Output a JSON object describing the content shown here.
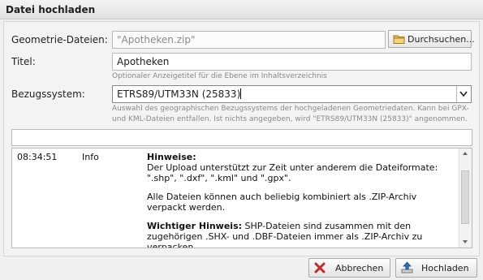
{
  "dialog": {
    "title": "Datei hochladen"
  },
  "form": {
    "file_label": "Geometrie-Dateien:",
    "file_value": "\"Apotheken.zip\"",
    "browse_label": "Durchsuchen...",
    "title_label": "Titel:",
    "title_value": "Apotheken",
    "title_hint": "Optionaler Anzeigetitel für die Ebene im Inhaltsverzeichnis",
    "crs_label": "Bezugssystem:",
    "crs_value": "ETRS89/UTM33N (25833)",
    "crs_hint_1": "Auswahl des geographischen Bezugssystems der hochgeladenen Geometriedaten. Kann bei GPX-",
    "crs_hint_2": "und KML-Dateien entfallen. Ist nichts angegeben, wird \"ETRS89/UTM33N (25833)\" angenommen."
  },
  "log": {
    "time": "08:34:51",
    "level": "Info",
    "heading": "Hinweise:",
    "line1": "Der Upload unterstützt zur Zeit unter anderem die Dateiformate: \".shp\", \".dxf\", \".kml\" und \".gpx\".",
    "line2": "Alle Dateien können auch beliebig kombiniert als .ZIP-Archiv verpackt werden.",
    "important_label": "Wichtiger Hinweis:",
    "important_text": " SHP-Dateien sind zusammen mit den zugehörigen .SHX- und .DBF-Dateien immer als .ZIP-Archiv zu verpacken."
  },
  "footer": {
    "cancel_label": "Abbrechen",
    "upload_label": "Hochladen"
  },
  "colors": {
    "cancel_icon": "#c62828",
    "upload_icon": "#2e6fb5",
    "folder_icon": "#e8b84a"
  }
}
